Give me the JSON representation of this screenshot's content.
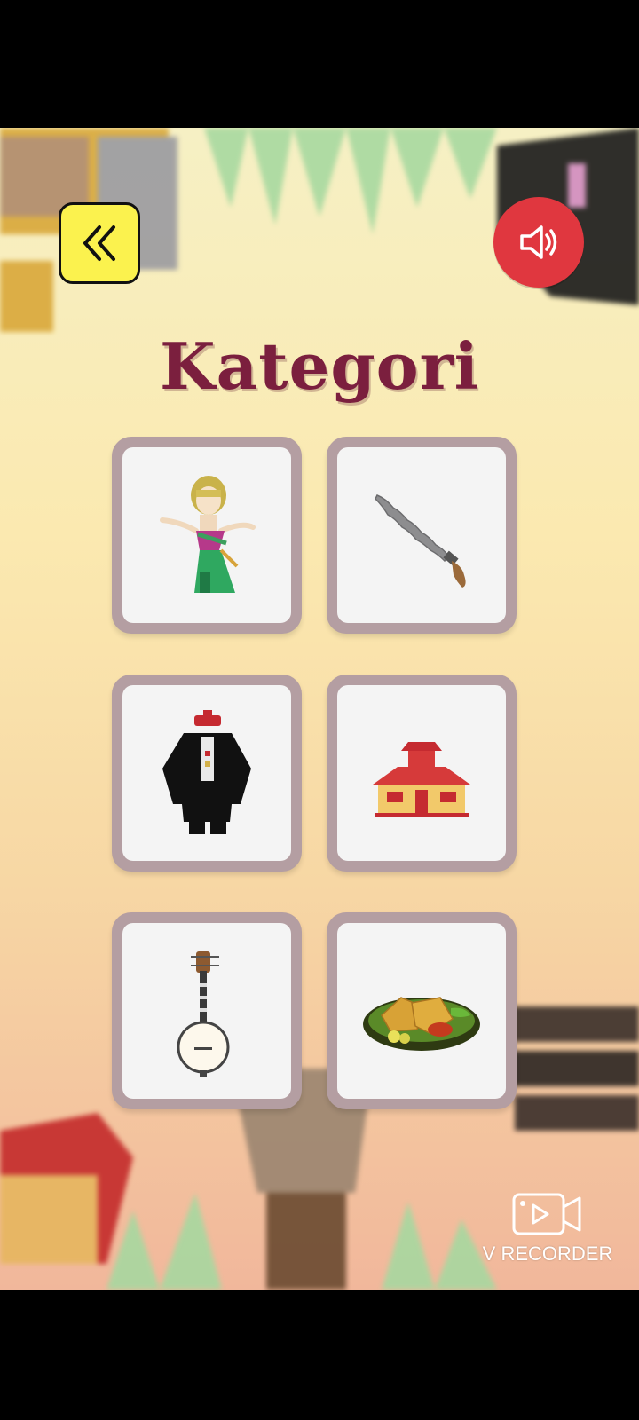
{
  "header": {
    "back_icon": "double-chevron-left-icon",
    "sound_icon": "speaker-icon",
    "accent_yellow": "#fbf24e",
    "accent_red": "#e0373f"
  },
  "title": "Kategori",
  "categories": [
    {
      "icon": "dancer-icon"
    },
    {
      "icon": "keris-dagger-icon"
    },
    {
      "icon": "traditional-clothing-icon"
    },
    {
      "icon": "traditional-house-icon"
    },
    {
      "icon": "lute-instrument-icon"
    },
    {
      "icon": "food-plate-icon"
    }
  ],
  "watermark": {
    "label": "V RECORDER",
    "icon": "video-camera-icon"
  }
}
